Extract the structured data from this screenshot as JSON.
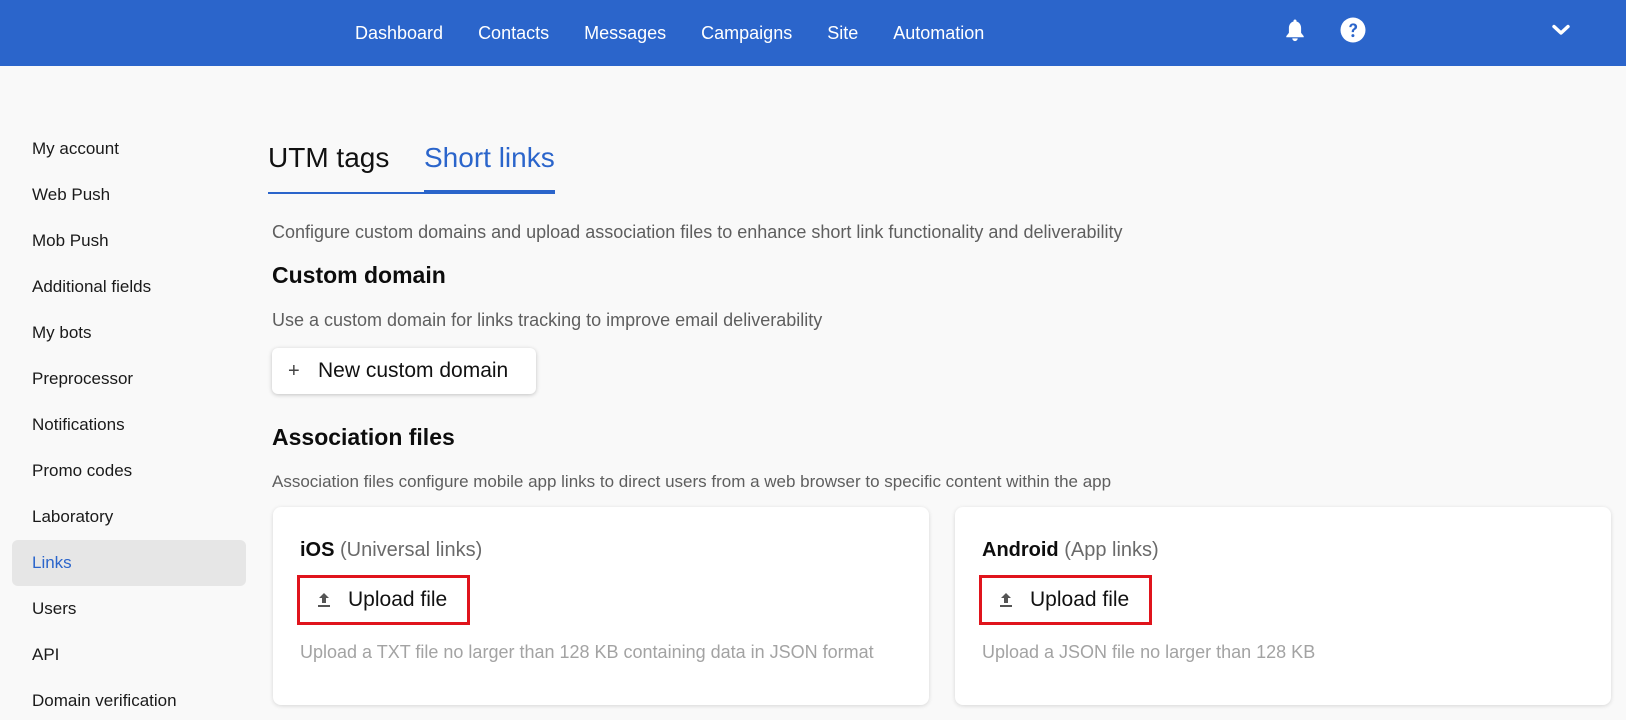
{
  "topnav": {
    "items": [
      "Dashboard",
      "Contacts",
      "Messages",
      "Campaigns",
      "Site",
      "Automation"
    ],
    "icons": [
      "bell-icon",
      "help-icon",
      "chevron-down-icon"
    ]
  },
  "colors": {
    "brand": "#2b65cb",
    "highlight_border": "#e0141c",
    "active_sidebar_bg": "#e6e6e6"
  },
  "sidebar": {
    "items": [
      {
        "label": "My account"
      },
      {
        "label": "Web Push"
      },
      {
        "label": "Mob Push"
      },
      {
        "label": "Additional fields"
      },
      {
        "label": "My bots"
      },
      {
        "label": "Preprocessor"
      },
      {
        "label": "Notifications"
      },
      {
        "label": "Promo codes"
      },
      {
        "label": "Laboratory"
      },
      {
        "label": "Links",
        "active": true
      },
      {
        "label": "Users"
      },
      {
        "label": "API"
      },
      {
        "label": "Domain verification"
      }
    ]
  },
  "tabs": [
    {
      "label": "UTM tags",
      "active": false
    },
    {
      "label": "Short links",
      "active": true
    }
  ],
  "main": {
    "lead": "Configure custom domains and upload association files to enhance short link functionality and deliverability",
    "custom_domain": {
      "title": "Custom domain",
      "description": "Use a custom domain for links tracking to improve email deliverability",
      "button_icon": "plus-icon",
      "button_label": "New custom domain"
    },
    "association_files": {
      "title": "Association files",
      "description": "Association files configure mobile app links to direct users from a web browser to specific content within the app",
      "cards": [
        {
          "platform": "iOS",
          "subtitle": "(Universal links)",
          "button_icon": "upload-icon",
          "button_label": "Upload file",
          "hint": "Upload a TXT file no larger than 128 KB containing data in JSON format"
        },
        {
          "platform": "Android",
          "subtitle": "(App links)",
          "button_icon": "upload-icon",
          "button_label": "Upload file",
          "hint": "Upload a JSON file no larger than 128 KB"
        }
      ]
    }
  }
}
